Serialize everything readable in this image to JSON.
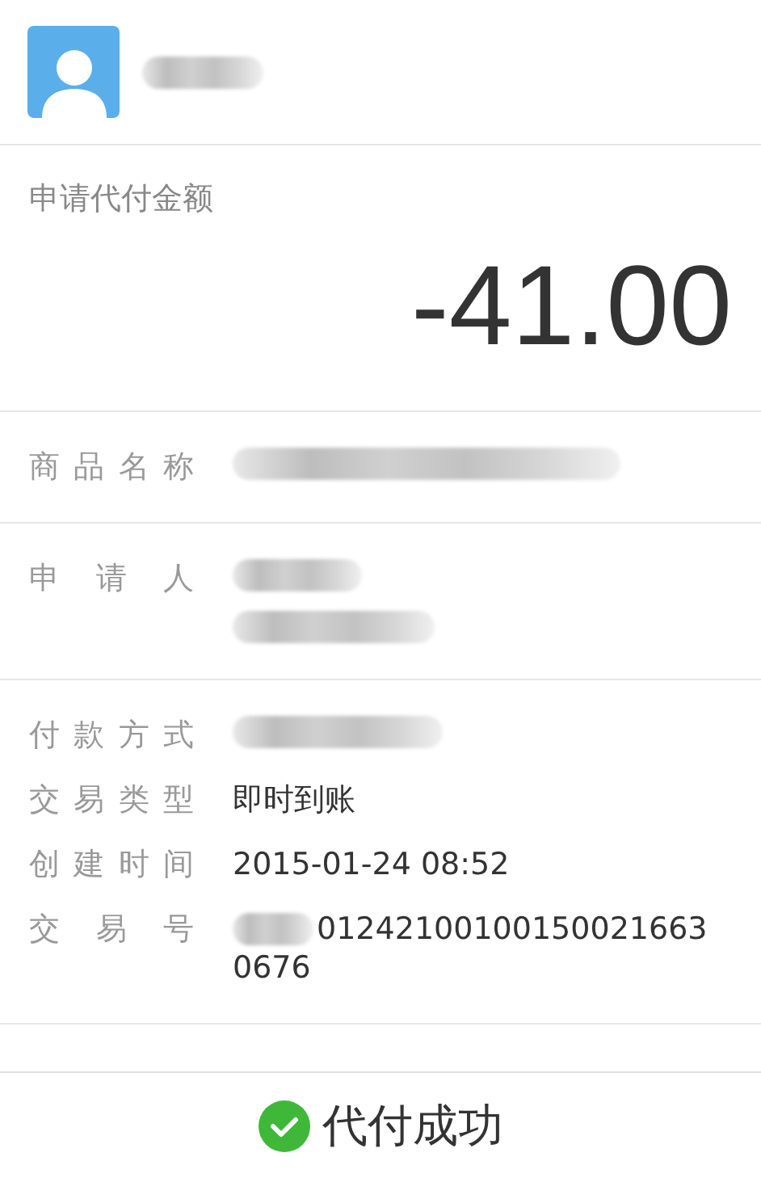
{
  "header": {
    "name": {
      "kind": "redacted"
    }
  },
  "amount": {
    "label": "申请代付金额",
    "value": "-41.00"
  },
  "sections": [
    {
      "rows": [
        {
          "label": "商品名称",
          "kind": "redacted",
          "lines": []
        }
      ]
    },
    {
      "rows": [
        {
          "label": "申请人",
          "kind": "redacted2",
          "lines": []
        }
      ]
    },
    {
      "rows": [
        {
          "label": "付款方式",
          "kind": "redacted",
          "lines": []
        },
        {
          "label": "交易类型",
          "kind": "text",
          "lines": [
            "即时到账"
          ]
        },
        {
          "label": "创建时间",
          "kind": "text",
          "lines": [
            "2015-01-24 08:52"
          ]
        },
        {
          "label": "交易号",
          "kind": "prefix-redacted",
          "lines": [
            "01242100100150021663",
            "0676"
          ]
        }
      ]
    }
  ],
  "status": {
    "text": "代付成功",
    "success": true
  }
}
